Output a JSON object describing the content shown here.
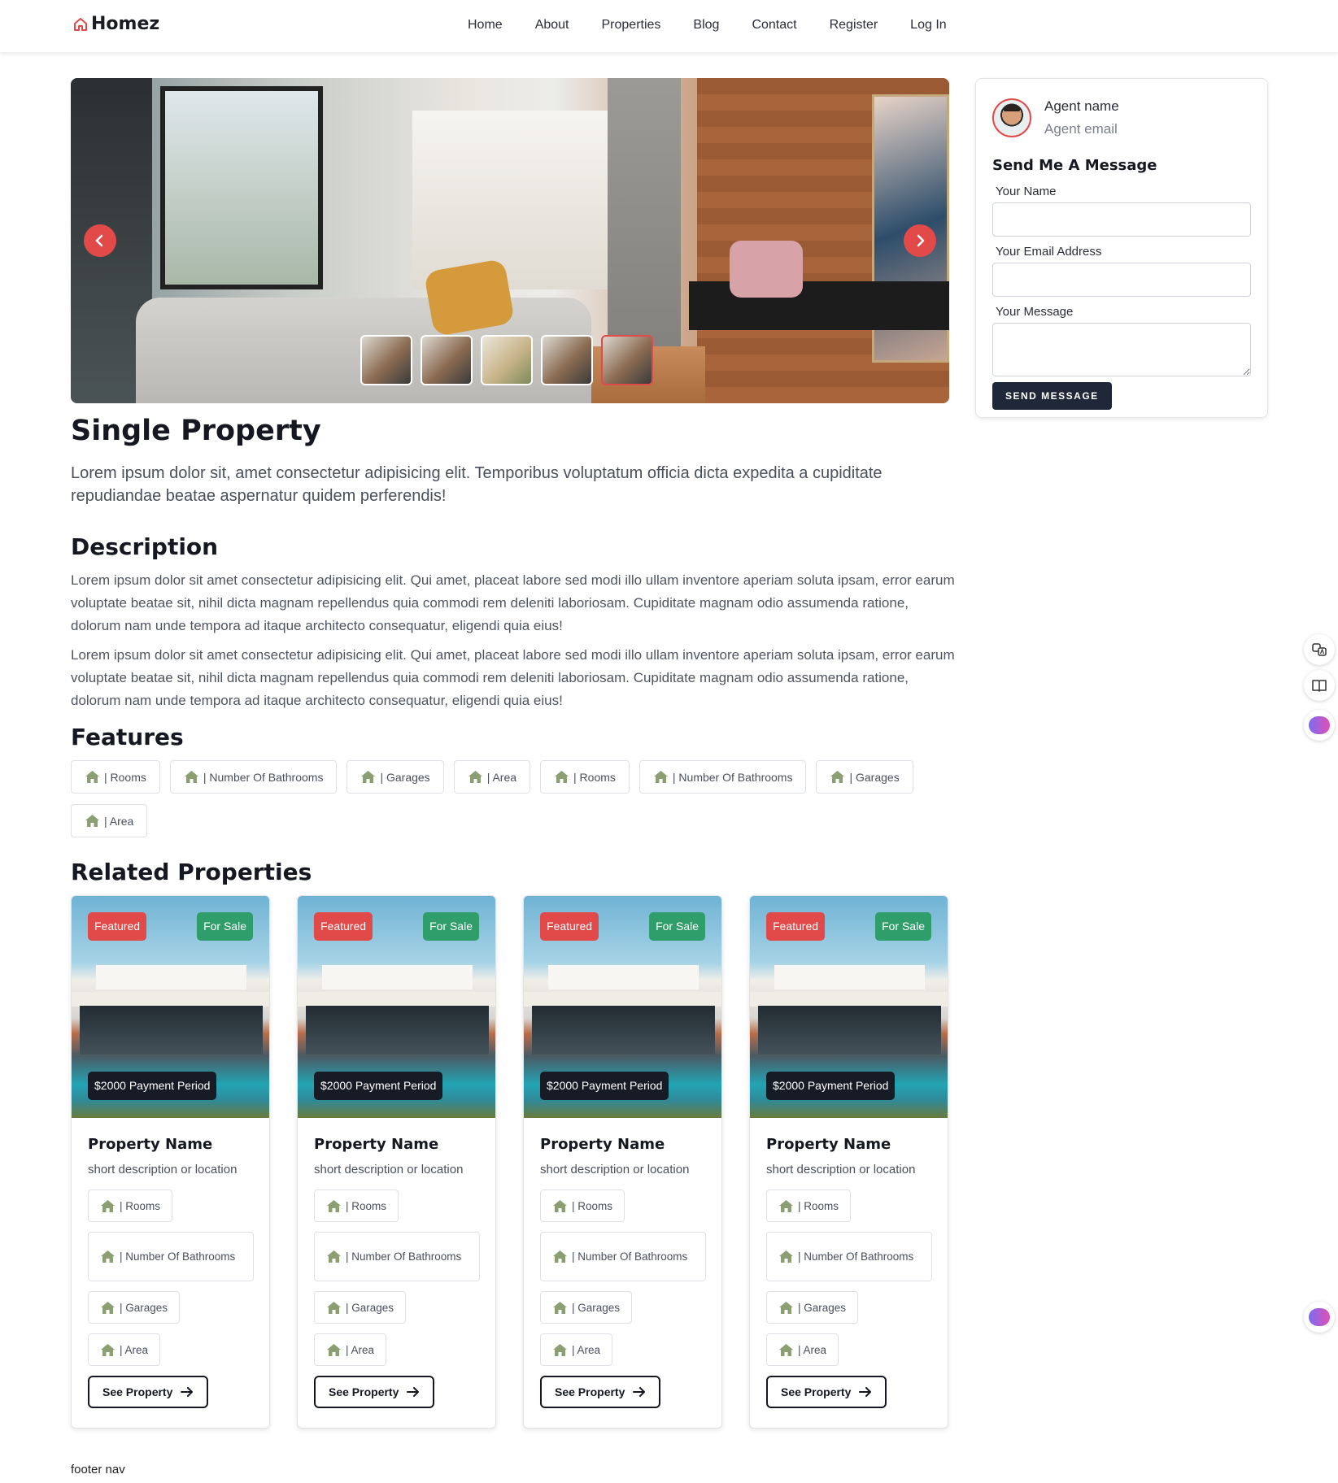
{
  "brand": {
    "name": "Homez",
    "accent": "#e24a4a"
  },
  "nav": {
    "links": [
      "Home",
      "About",
      "Properties",
      "Blog",
      "Contact",
      "Register",
      "Log In"
    ]
  },
  "gallery": {
    "prev_icon": "chevron-left-icon",
    "next_icon": "chevron-right-icon",
    "thumbnail_count": 5,
    "active_thumbnail": 5
  },
  "property": {
    "title": "Single Property",
    "lead": "Lorem ipsum dolor sit, amet consectetur adipisicing elit. Temporibus voluptatum officia dicta expedita a cupiditate repudiandae beatae aspernatur quidem perferendis!",
    "description_heading": "Description",
    "description_paragraphs": [
      "Lorem ipsum dolor sit amet consectetur adipisicing elit. Qui amet, placeat labore sed modi illo ullam inventore aperiam soluta ipsam, error earum voluptate beatae sit, nihil dicta magnam repellendus quia commodi rem deleniti laboriosam. Cupiditate magnam odio assumenda ratione, dolorum nam unde tempora ad itaque architecto consequatur, eligendi quia eius!",
      "Lorem ipsum dolor sit amet consectetur adipisicing elit. Qui amet, placeat labore sed modi illo ullam inventore aperiam soluta ipsam, error earum voluptate beatae sit, nihil dicta magnam repellendus quia commodi rem deleniti laboriosam. Cupiditate magnam odio assumenda ratione, dolorum nam unde tempora ad itaque architecto consequatur, eligendi quia eius!"
    ],
    "features_heading": "Features",
    "features": [
      "| Rooms",
      "| Number Of Bathrooms",
      "| Garages",
      "| Area",
      "| Rooms",
      "| Number Of Bathrooms",
      "| Garages",
      "| Area"
    ],
    "feature_icon": "home-icon",
    "feature_icon_color": "#8c9f73"
  },
  "related": {
    "heading": "Related Properties",
    "cards": [
      {
        "featured": "Featured",
        "status": "For Sale",
        "price": "$2000 Payment Period",
        "name": "Property Name",
        "desc": "short description or location",
        "chips": [
          "| Rooms",
          "| Number Of Bathrooms",
          "| Garages",
          "| Area"
        ],
        "button": "See Property"
      },
      {
        "featured": "Featured",
        "status": "For Sale",
        "price": "$2000 Payment Period",
        "name": "Property Name",
        "desc": "short description or location",
        "chips": [
          "| Rooms",
          "| Number Of Bathrooms",
          "| Garages",
          "| Area"
        ],
        "button": "See Property"
      },
      {
        "featured": "Featured",
        "status": "For Sale",
        "price": "$2000 Payment Period",
        "name": "Property Name",
        "desc": "short description or location",
        "chips": [
          "| Rooms",
          "| Number Of Bathrooms",
          "| Garages",
          "| Area"
        ],
        "button": "See Property"
      },
      {
        "featured": "Featured",
        "status": "For Sale",
        "price": "$2000 Payment Period",
        "name": "Property Name",
        "desc": "short description or location",
        "chips": [
          "| Rooms",
          "| Number Of Bathrooms",
          "| Garages",
          "| Area"
        ],
        "button": "See Property"
      }
    ],
    "badge_colors": {
      "featured": "#e24a4a",
      "for_sale": "#2f9e6a",
      "price": "#171b26"
    }
  },
  "footer": {
    "label": "footer nav"
  },
  "agent": {
    "name": "Agent name",
    "email": "Agent email",
    "form_title": "Send Me A Message",
    "labels": {
      "name": "Your Name",
      "email": "Your Email Address",
      "message": "Your Message"
    },
    "values": {
      "name": "",
      "email": "",
      "message": ""
    },
    "send_label": "SEND MESSAGE"
  },
  "side_tools": [
    "translate-icon",
    "book-reader-icon",
    "brain-icon",
    "brain-icon"
  ]
}
